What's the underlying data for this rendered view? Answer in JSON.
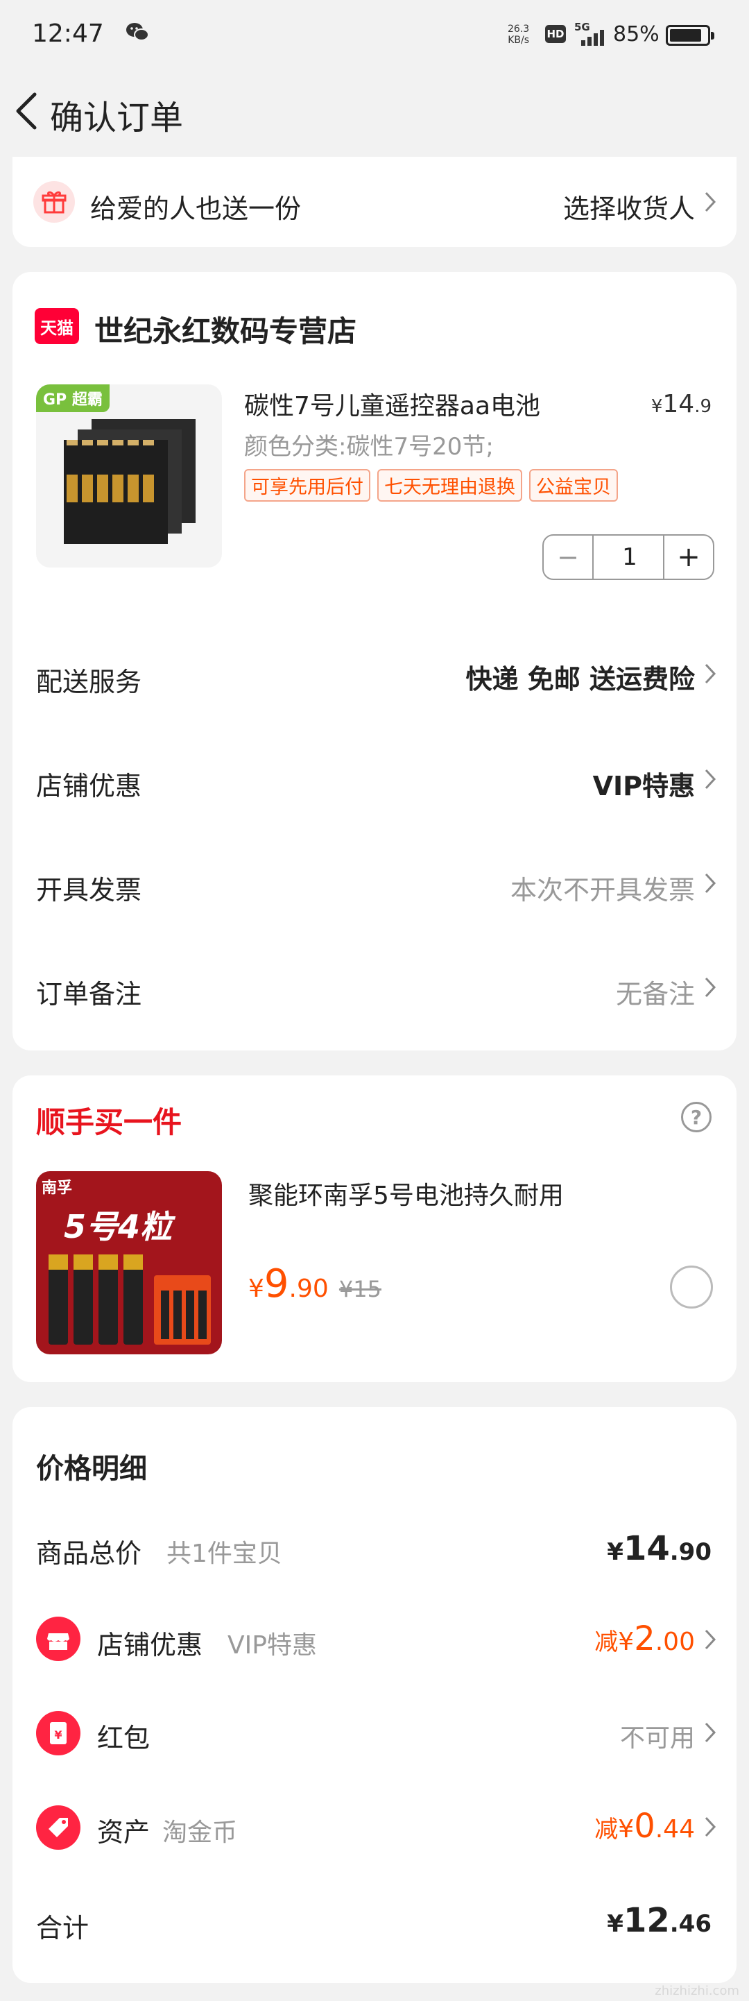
{
  "status_bar": {
    "time": "12:47",
    "net_speed": "26.3",
    "net_unit": "KB/s",
    "hd": "HD",
    "signal": "5G",
    "battery": "85%"
  },
  "header": {
    "title": "确认订单"
  },
  "gift": {
    "label": "给爱的人也送一份",
    "action": "选择收货人"
  },
  "store": {
    "badge": "天猫",
    "name": "世纪永红数码专营店",
    "product": {
      "image_badge": "GP 超霸",
      "title": "碳性7号儿童遥控器aa电池",
      "price_symbol": "¥",
      "price_int": "14",
      "price_dec": ".9",
      "variant": "颜色分类:碳性7号20节;",
      "tags": [
        "可享先用后付",
        "七天无理由退换",
        "公益宝贝"
      ],
      "quantity": "1",
      "minus": "−",
      "plus": "+"
    },
    "rows": [
      {
        "label": "配送服务",
        "value": "快递 免邮 送运费险",
        "strong": true
      },
      {
        "label": "店铺优惠",
        "value": "VIP特惠",
        "strong": true
      },
      {
        "label": "开具发票",
        "value": "本次不开具发票",
        "strong": false
      },
      {
        "label": "订单备注",
        "value": "无备注",
        "strong": false
      }
    ]
  },
  "addon": {
    "title": "顺手买一件",
    "help": "?",
    "product": {
      "image_title": "5号4粒",
      "image_brand": "南孚",
      "title": "聚能环南孚5号电池持久耐用",
      "price_symbol": "¥",
      "price_int": "9",
      "price_dec": ".90",
      "orig_price": "¥15"
    }
  },
  "price_detail": {
    "title": "价格明细",
    "rows": [
      {
        "label": "商品总价",
        "sub": "共1件宝贝",
        "prefix": "",
        "symbol": "¥",
        "int": "14",
        "dec": ".90",
        "highlight": false
      },
      {
        "label": "店铺优惠",
        "sub": "VIP特惠",
        "prefix": "减",
        "symbol": "¥",
        "int": "2",
        "dec": ".00",
        "highlight": true
      },
      {
        "label": "红包",
        "sub": "",
        "value": "不可用",
        "highlight": false
      },
      {
        "label": "资产",
        "sub": "淘金币",
        "prefix": "减",
        "symbol": "¥",
        "int": "0",
        "dec": ".44",
        "highlight": true
      }
    ],
    "total_label": "合计",
    "total_symbol": "¥",
    "total_int": "12",
    "total_dec": ".46"
  },
  "watermark": {
    "text": "zhizhizhi.com"
  },
  "colors": {
    "accent": "#ff5000",
    "tmall_red": "#ff0036",
    "bg": "#f2f2f2"
  }
}
